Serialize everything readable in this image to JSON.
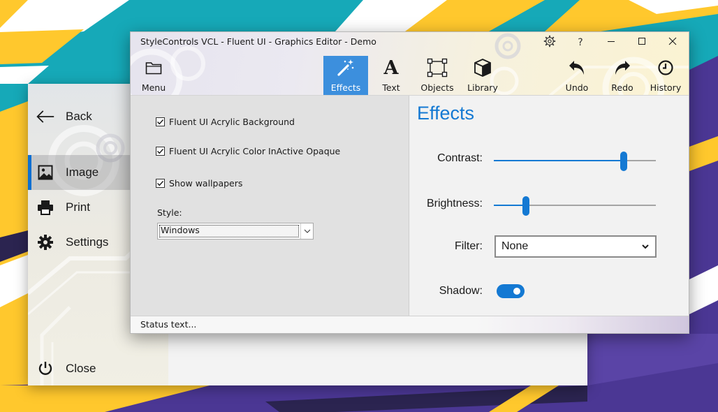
{
  "backstage": {
    "items": [
      {
        "label": "Back",
        "icon": "arrow-left-icon"
      },
      {
        "label": "Image",
        "icon": "image-icon",
        "selected": true
      },
      {
        "label": "Print",
        "icon": "printer-icon"
      },
      {
        "label": "Settings",
        "icon": "gear-icon"
      },
      {
        "label": "Close",
        "icon": "power-icon"
      }
    ]
  },
  "window": {
    "title": "StyleControls VCL - Fluent UI - Graphics Editor - Demo",
    "caption_buttons": [
      {
        "label": "?",
        "icon": "help-icon"
      }
    ]
  },
  "toolbar": {
    "menu": "Menu",
    "effects": "Effects",
    "text": "Text",
    "objects": "Objects",
    "library": "Library",
    "undo": "Undo",
    "redo": "Redo",
    "history": "History",
    "active_tab": "Effects"
  },
  "options": {
    "checkboxes": [
      {
        "label": "Fluent UI Acrylic Background",
        "checked": true
      },
      {
        "label": "Fluent UI Acrylic Color InActive Opaque",
        "checked": true
      },
      {
        "label": "Show wallpapers",
        "checked": true
      }
    ],
    "style_label": "Style:",
    "style_value": "Windows"
  },
  "effects": {
    "title": "Effects",
    "contrast_label": "Contrast:",
    "contrast_level": 0.8,
    "brightness_label": "Brightness:",
    "brightness_level": 0.2,
    "filter_label": "Filter:",
    "filter_value": "None",
    "shadow_label": "Shadow:",
    "shadow_on": true
  },
  "status": {
    "text": "Status text..."
  },
  "colors": {
    "accent": "#1479d3",
    "tab_active": "#3c8fdd",
    "wallpaper_teal": "#16a9b8",
    "wallpaper_purple": "#4b3794",
    "wallpaper_yellow": "#ffc82d"
  }
}
